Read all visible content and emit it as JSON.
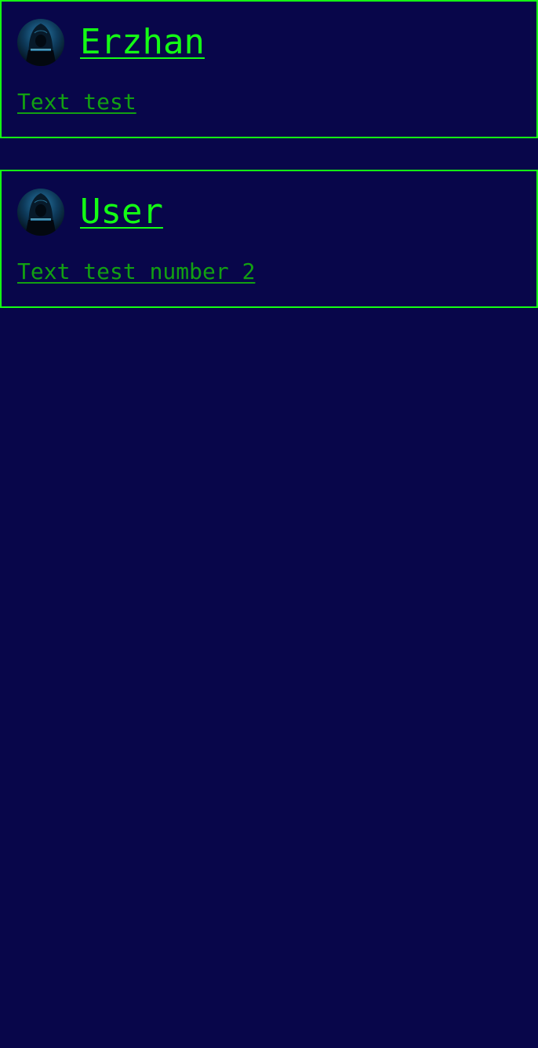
{
  "theme": {
    "background": "#08064a",
    "border": "#14ff14",
    "author_color": "#14ff14",
    "message_color": "#12a012"
  },
  "posts": [
    {
      "author": "Erzhan",
      "text": "Text test",
      "avatar_icon": "hooded-hacker-avatar-icon"
    },
    {
      "author": "User",
      "text": "Text test number 2",
      "avatar_icon": "hooded-hacker-avatar-icon"
    }
  ]
}
